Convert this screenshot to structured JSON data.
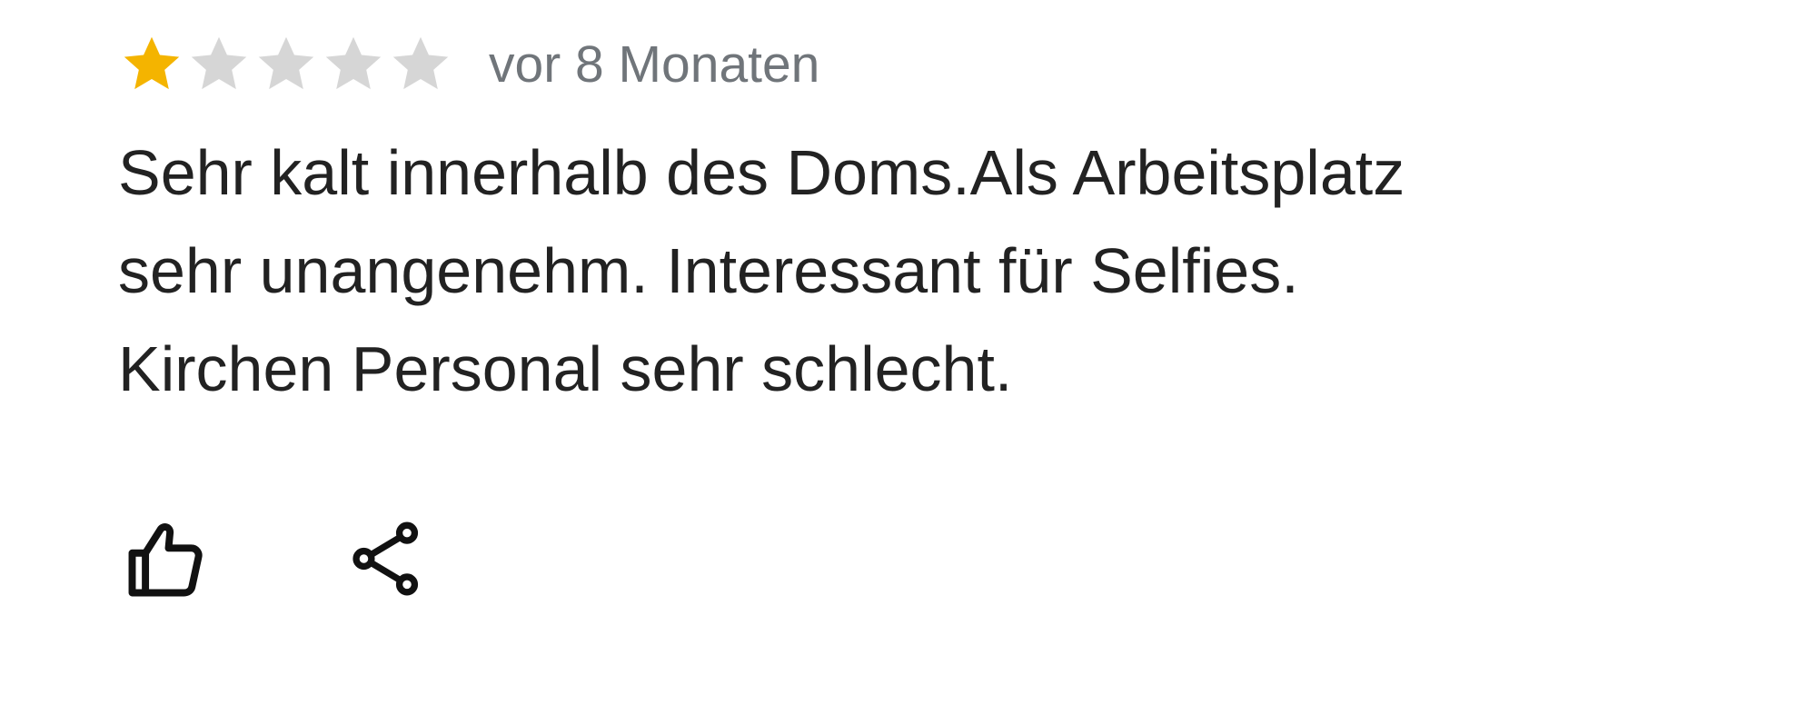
{
  "review": {
    "rating": 1,
    "max_rating": 5,
    "date": "vor 8 Monaten",
    "text_lines": [
      "Sehr kalt innerhalb des Doms.Als Arbeitsplatz",
      "sehr unangenehm. Interessant für Selfies.",
      "Kirchen Personal sehr schlecht."
    ]
  },
  "actions": {
    "like_icon": "thumbs-up-icon",
    "share_icon": "share-icon"
  },
  "colors": {
    "star_filled": "#f4b400",
    "star_empty": "#d6d6d6",
    "text": "#222222",
    "date": "#70757a",
    "icon": "#111111"
  }
}
